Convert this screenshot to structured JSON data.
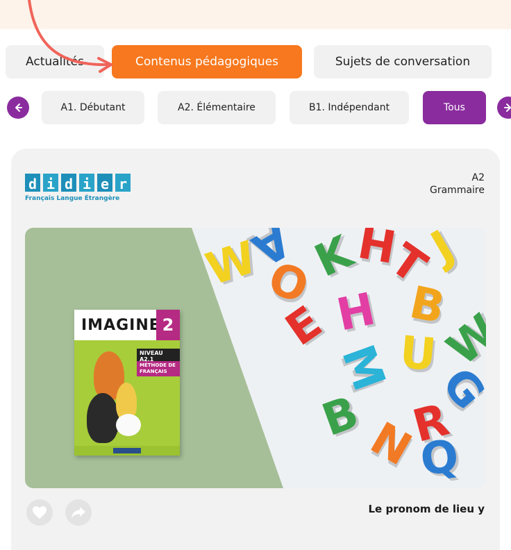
{
  "main_tabs": [
    {
      "label": "Actualités",
      "active": false
    },
    {
      "label": "Contenus pédagogiques",
      "active": true
    },
    {
      "label": "Sujets de conversation",
      "active": false
    }
  ],
  "level_filters": [
    {
      "label": "A1. Débutant",
      "active": false
    },
    {
      "label": "A2. Élémentaire",
      "active": false
    },
    {
      "label": "B1. Indépendant",
      "active": false
    },
    {
      "label": "Tous",
      "active": true
    }
  ],
  "nav_icons": {
    "prev": "arrow-left-icon",
    "next": "arrow-right-icon"
  },
  "card": {
    "publisher_logo": "didier",
    "publisher_tagline": "Français Langue Étrangère",
    "level": "A2",
    "category": "Grammaire",
    "book": {
      "title": "IMAGINE",
      "number": "2",
      "level_badge": "NIVEAU A2.1",
      "subtitle": "MÉTHODE DE FRANÇAIS"
    },
    "title": "Le pronom de lieu y",
    "actions": [
      {
        "name": "like",
        "icon": "heart-icon"
      },
      {
        "name": "share",
        "icon": "share-arrow-icon"
      }
    ]
  },
  "colors": {
    "active_tab": "#f7781e",
    "active_chip": "#8a2c9e",
    "brand_blue": "#1e8fb9",
    "annotation_arrow": "#f0645a"
  }
}
